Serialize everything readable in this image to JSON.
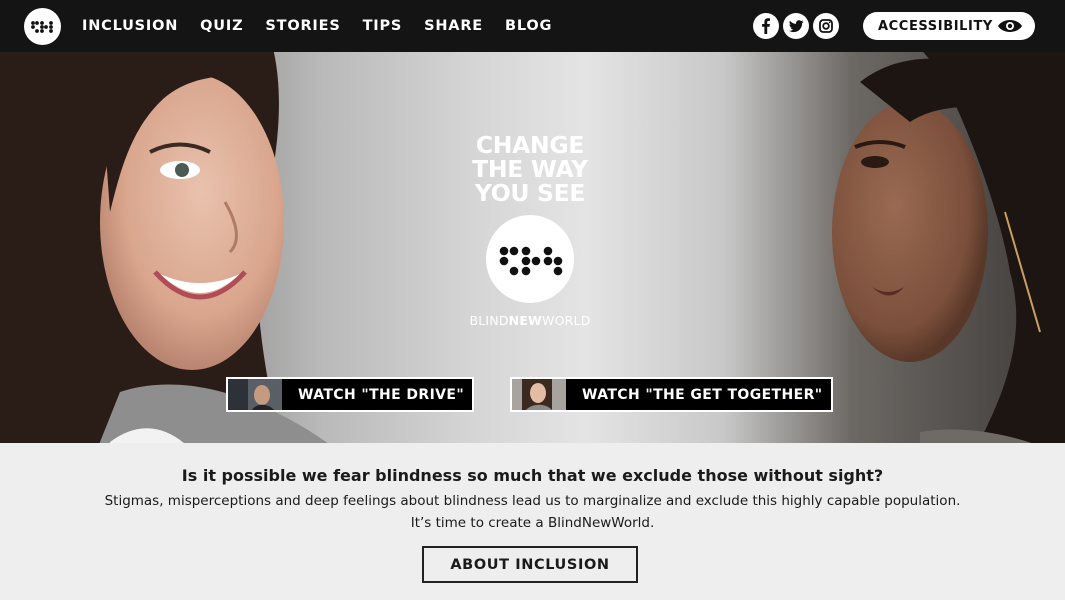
{
  "nav": {
    "logo_icon": "braille-logo-icon",
    "links": [
      "INCLUSION",
      "QUIZ",
      "STORIES",
      "TIPS",
      "SHARE",
      "BLOG"
    ],
    "social": [
      "facebook-icon",
      "twitter-icon",
      "instagram-icon"
    ],
    "accessibility_label": "ACCESSIBILITY",
    "accessibility_icon": "eye-icon"
  },
  "hero": {
    "tagline": [
      "CHANGE",
      "THE WAY",
      "YOU SEE"
    ],
    "logo_icon": "braille-logo-icon",
    "wordmark": {
      "part1": "BLIND",
      "part2": "NEW",
      "part3": "WORLD"
    },
    "buttons": [
      {
        "label": "WATCH \"THE DRIVE\"",
        "thumbnail": "video-thumbnail"
      },
      {
        "label": "WATCH \"THE GET TOGETHER\"",
        "thumbnail": "video-thumbnail"
      }
    ]
  },
  "info": {
    "heading": "Is it possible we fear blindness so much that we exclude those without sight?",
    "body_line1": "Stigmas, misperceptions and deep feelings about blindness lead us to marginalize and exclude this highly capable population.",
    "body_line2": "It’s time to create a BlindNewWorld.",
    "button_label": "ABOUT INCLUSION"
  },
  "colors": {
    "navbar": "#141414",
    "text_dark": "#1a1a1a",
    "info_bg": "#eeeeee",
    "button_bg": "#000000"
  }
}
